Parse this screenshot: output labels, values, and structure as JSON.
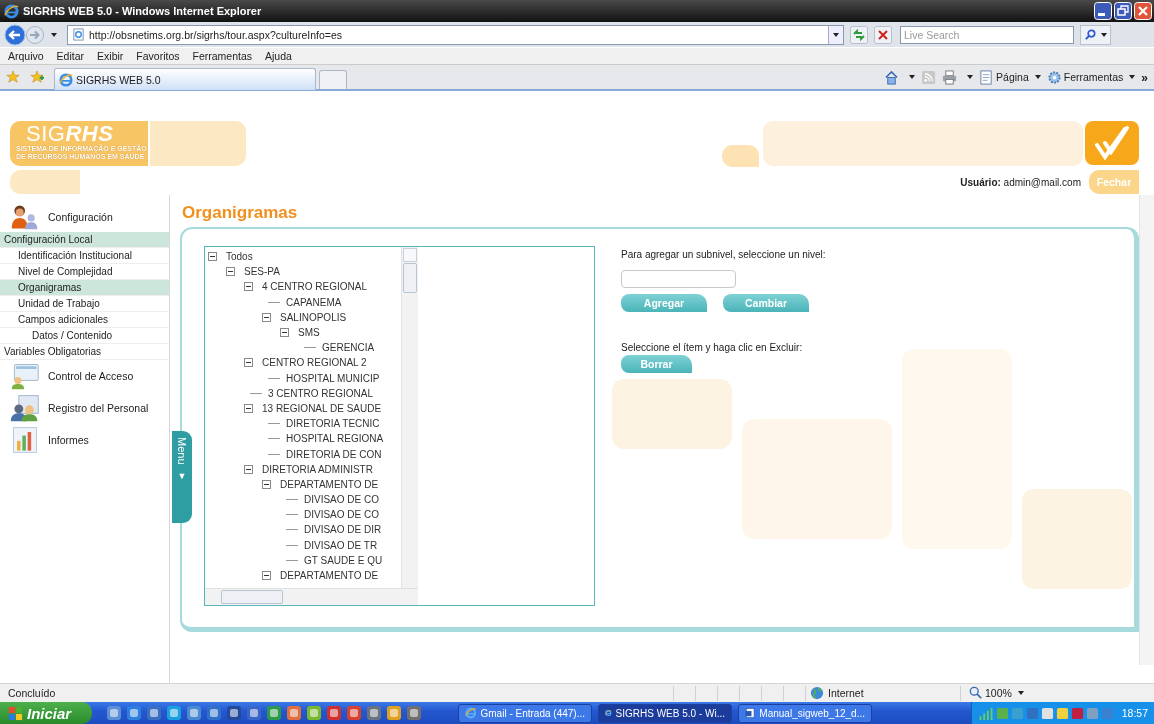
{
  "window": {
    "title": "SIGRHS WEB 5.0 - Windows Internet Explorer"
  },
  "address_bar": {
    "url": "http://obsnetims.org.br/sigrhs/tour.aspx?cultureInfo=es",
    "search_placeholder": "Live Search"
  },
  "menu_bar": [
    "Arquivo",
    "Editar",
    "Exibir",
    "Favoritos",
    "Ferramentas",
    "Ajuda"
  ],
  "tabs": [
    {
      "label": "SIGRHS WEB 5.0",
      "selected": true
    }
  ],
  "command_bar": {
    "page": "Página",
    "tools": "Ferramentas",
    "more": "»"
  },
  "header": {
    "logo_light": "SIG",
    "logo_bold": "RHS",
    "logo_subtitle": [
      "SISTEMA DE INFORMAÇÃO E GESTÃO",
      "DE RECURSOS HUMANOS EM SAÚDE"
    ],
    "user_label": "Usuário:",
    "user": "admin@mail.com",
    "close": "Fechar"
  },
  "sidebar": {
    "sections": [
      {
        "label": "Configuración",
        "kind": "config",
        "items": [
          {
            "label": "Configuración Local",
            "selected": true,
            "children": [
              {
                "label": "Identificación Institucional",
                "selected": false
              },
              {
                "label": "Nivel de Complejidad",
                "selected": false
              },
              {
                "label": "Organigramas",
                "selected": true
              },
              {
                "label": "Unidad de Trabajo",
                "selected": false
              },
              {
                "label": "Campos adicionales",
                "selected": false,
                "children": [
                  {
                    "label": "Datos / Contenido",
                    "selected": false
                  }
                ]
              }
            ]
          },
          {
            "label": "Variables Obligatorias",
            "selected": false
          }
        ]
      },
      {
        "label": "Control de Acceso",
        "kind": "access"
      },
      {
        "label": "Registro del Personal",
        "kind": "staff"
      },
      {
        "label": "Informes",
        "kind": "reports"
      }
    ]
  },
  "menu_tab": {
    "label": "Menu",
    "arrow": "▼"
  },
  "page_title": "Organigramas",
  "tree": [
    {
      "label": "Todos",
      "expanded": true,
      "children": [
        {
          "label": "SES-PA",
          "expanded": true,
          "children": [
            {
              "label": "4 CENTRO REGIONAL",
              "expanded": true,
              "children": [
                {
                  "label": "CAPANEMA"
                },
                {
                  "label": "SALINOPOLIS",
                  "expanded": true,
                  "children": [
                    {
                      "label": "SMS",
                      "expanded": true,
                      "children": [
                        {
                          "label": "GERENCIA"
                        }
                      ]
                    }
                  ]
                }
              ]
            },
            {
              "label": "CENTRO REGIONAL 2",
              "expanded": true,
              "children": [
                {
                  "label": "HOSPITAL MUNICIP"
                }
              ]
            },
            {
              "label": "3 CENTRO REGIONAL"
            },
            {
              "label": "13 REGIONAL DE SAUDE",
              "expanded": true,
              "children": [
                {
                  "label": "DIRETORIA TECNIC"
                },
                {
                  "label": "HOSPITAL REGIONA"
                },
                {
                  "label": "DIRETORIA DE CON"
                }
              ]
            },
            {
              "label": "DIRETORIA ADMINISTR",
              "expanded": true,
              "children": [
                {
                  "label": "DEPARTAMENTO DE",
                  "expanded": true,
                  "children": [
                    {
                      "label": "DIVISAO DE CO"
                    },
                    {
                      "label": "DIVISAO DE CO"
                    },
                    {
                      "label": "DIVISAO DE DIR"
                    },
                    {
                      "label": "DIVISAO DE TR"
                    },
                    {
                      "label": "GT SAUDE E QU"
                    }
                  ]
                },
                {
                  "label": "DEPARTAMENTO DE",
                  "expanded": true
                }
              ]
            }
          ]
        }
      ]
    }
  ],
  "form": {
    "add_hint": "Para agregar un subnivel, seleccione un nivel:",
    "add_button": "Agregar",
    "change_button": "Cambiar",
    "delete_hint": "Seleccione el ítem y haga clic en Excluir:",
    "delete_button": "Borrar"
  },
  "status_bar": {
    "text": "Concluído",
    "zone": "Internet",
    "zoom": "100%"
  },
  "taskbar": {
    "start": "Iniciar",
    "tasks": [
      {
        "label": "Gmail - Entrada (447)...",
        "kind": "browser",
        "selected": false
      },
      {
        "label": "SIGRHS WEB 5.0 - Wi...",
        "kind": "browser",
        "selected": true
      },
      {
        "label": "Manual_sigweb_12_d...",
        "kind": "document",
        "selected": false
      }
    ],
    "clock": "18:57"
  }
}
